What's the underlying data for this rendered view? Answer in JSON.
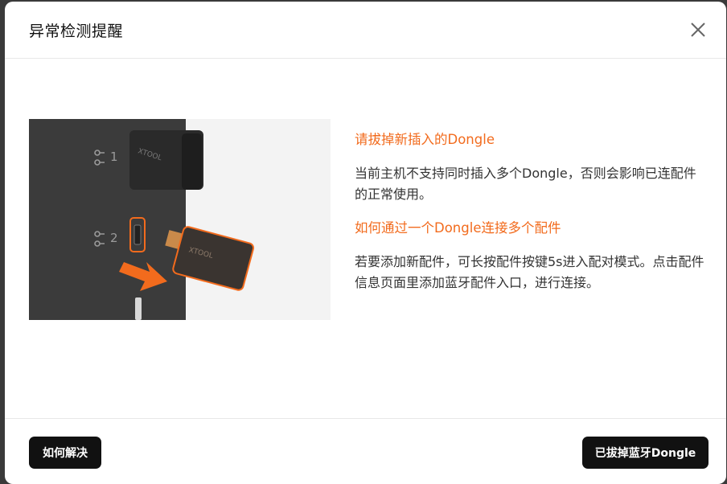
{
  "dialog": {
    "title": "异常检测提醒",
    "close_icon": "close-icon"
  },
  "illustration": {
    "brand": "XTOOL",
    "port1_label": "1",
    "port2_label": "2",
    "accent_color": "#f26b1d"
  },
  "content": {
    "heading1": "请拔掉新插入的Dongle",
    "para1": "当前主机不支持同时插入多个Dongle，否则会影响已连配件的正常使用。",
    "heading2": "如何通过一个Dongle连接多个配件",
    "para2": "若要添加新配件，可长按配件按键5s进入配对模式。点击配件信息页面里添加蓝牙配件入口，进行连接。"
  },
  "footer": {
    "help_button": "如何解决",
    "confirm_button": "已拔掉蓝牙Dongle"
  }
}
